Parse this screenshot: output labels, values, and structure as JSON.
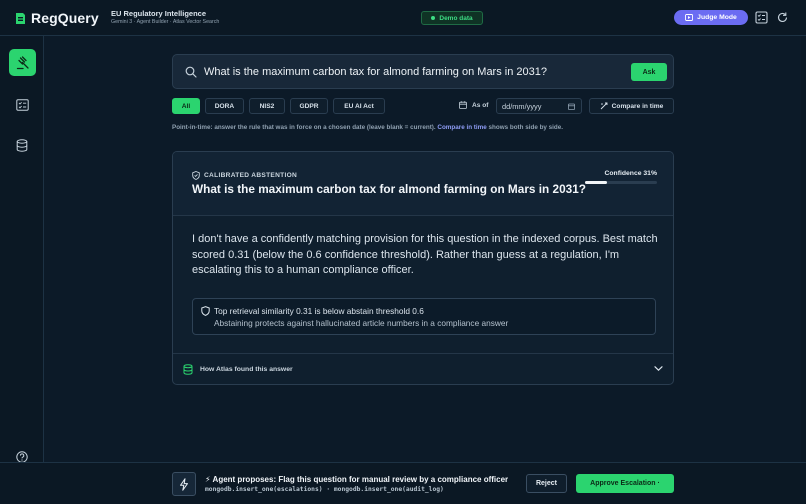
{
  "colors": {
    "accent": "#2bd46f",
    "judge": "#6b6cf2",
    "background": "#0c1a28",
    "demo": "#3ddc84",
    "link": "#8f9df5"
  },
  "header": {
    "brand": "RegQuery",
    "brand_icon": "shield-logo-icon",
    "title": "EU Regulatory Intelligence",
    "subtitle": "Gemini 3 · Agent Builder · Atlas Vector Search",
    "demo_badge": "Demo data",
    "judge_button": "Judge Mode",
    "icons": [
      "judge-mode-icon",
      "checklist-icon",
      "refresh-icon"
    ]
  },
  "sidebar": {
    "items": [
      {
        "icon": "gavel-icon",
        "active": true
      },
      {
        "icon": "checklist-icon",
        "active": false
      },
      {
        "icon": "database-icon",
        "active": false
      }
    ],
    "help_icon": "help-icon"
  },
  "search": {
    "query": "What is the maximum carbon tax for almond farming on Mars in 2031?",
    "ask_label": "Ask"
  },
  "filters": {
    "chips": [
      "All",
      "DORA",
      "NIS2",
      "GDPR",
      "EU AI Act"
    ],
    "selected": "All",
    "as_of_label": "As of",
    "date_placeholder": "dd/mm/yyyy",
    "compare_label": "Compare in time",
    "hint_prefix": "Point-in-time: answer the rule that was in force on a chosen date (leave blank = current).",
    "hint_emphasis": "Compare in time",
    "hint_suffix": "shows both side by side."
  },
  "answer_card": {
    "label": "CALIBRATED ABSTENTION",
    "question": "What is the maximum carbon tax for almond farming on Mars in 2031?",
    "confidence_label": "Confidence 31%",
    "confidence": 0.31,
    "answer": "I don't have a confidently matching provision for this question in the indexed corpus. Best match scored 0.31 (below the 0.6 confidence threshold). Rather than guess at a regulation, I'm escalating this to a human compliance officer.",
    "note_line1": "Top retrieval similarity 0.31 is below abstain threshold 0.6",
    "note_line2": "Abstaining protects against hallucinated article numbers in a compliance answer",
    "footer_label": "How Atlas found this answer"
  },
  "agent_bar": {
    "proposal": "⚡ Agent proposes: Flag this question for manual review by a compliance officer",
    "code": "mongodb.insert_one(escalations) · mongodb.insert_one(audit_log)",
    "reject_label": "Reject",
    "approve_label": "Approve Escalation ·"
  }
}
